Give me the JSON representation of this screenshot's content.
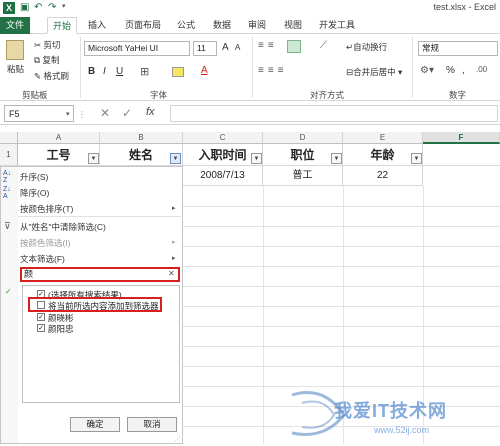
{
  "titlebar": {
    "title": "test.xlsx - Excel",
    "app_icon": "X"
  },
  "tabs": [
    "文件",
    "开始",
    "插入",
    "页面布局",
    "公式",
    "数据",
    "审阅",
    "视图",
    "开发工具"
  ],
  "ribbon": {
    "paste": "粘贴",
    "cut": "剪切",
    "copy": "复制",
    "format_painter": "格式刷",
    "clipboard_label": "剪贴板",
    "font_name": "Microsoft YaHei UI",
    "font_size": "11",
    "font_label": "字体",
    "wrap_text": "自动换行",
    "merge_center": "合并后居中",
    "align_label": "对齐方式",
    "number_format": "常规",
    "number_label": "数字",
    "bold": "B",
    "italic": "I",
    "underline": "U",
    "grow": "A",
    "shrink": "A",
    "font_color": "A",
    "currency": "%",
    "comma": ","
  },
  "formula_bar": {
    "name_box": "F5",
    "cancel": "✕",
    "enter": "✓",
    "fx": "fx",
    "value": ""
  },
  "columns": [
    "A",
    "B",
    "C",
    "D",
    "E",
    "F"
  ],
  "row_numbers": [
    "1"
  ],
  "headers": [
    "工号",
    "姓名",
    "入职时间",
    "职位",
    "年龄"
  ],
  "row2": [
    "2008/7/13",
    "普工",
    "22"
  ],
  "filter_menu": {
    "sort_asc": "升序(S)",
    "sort_desc": "降序(O)",
    "sort_color": "按颜色排序(T)",
    "clear_filter": "从\"姓名\"中清除筛选(C)",
    "color_filter": "按颜色筛选(I)",
    "text_filter": "文本筛选(F)",
    "search_value": "颜",
    "items": [
      {
        "label": "(选择所有搜索结果)",
        "checked": true
      },
      {
        "label": "将当前所选内容添加到筛选器",
        "checked": false
      },
      {
        "label": "颜晓彬",
        "checked": true
      },
      {
        "label": "颜阳忠",
        "checked": true
      }
    ],
    "ok": "确定",
    "cancel": "取消"
  },
  "watermark": {
    "text": "我爱IT技术网",
    "url": "www.52ij.com"
  }
}
